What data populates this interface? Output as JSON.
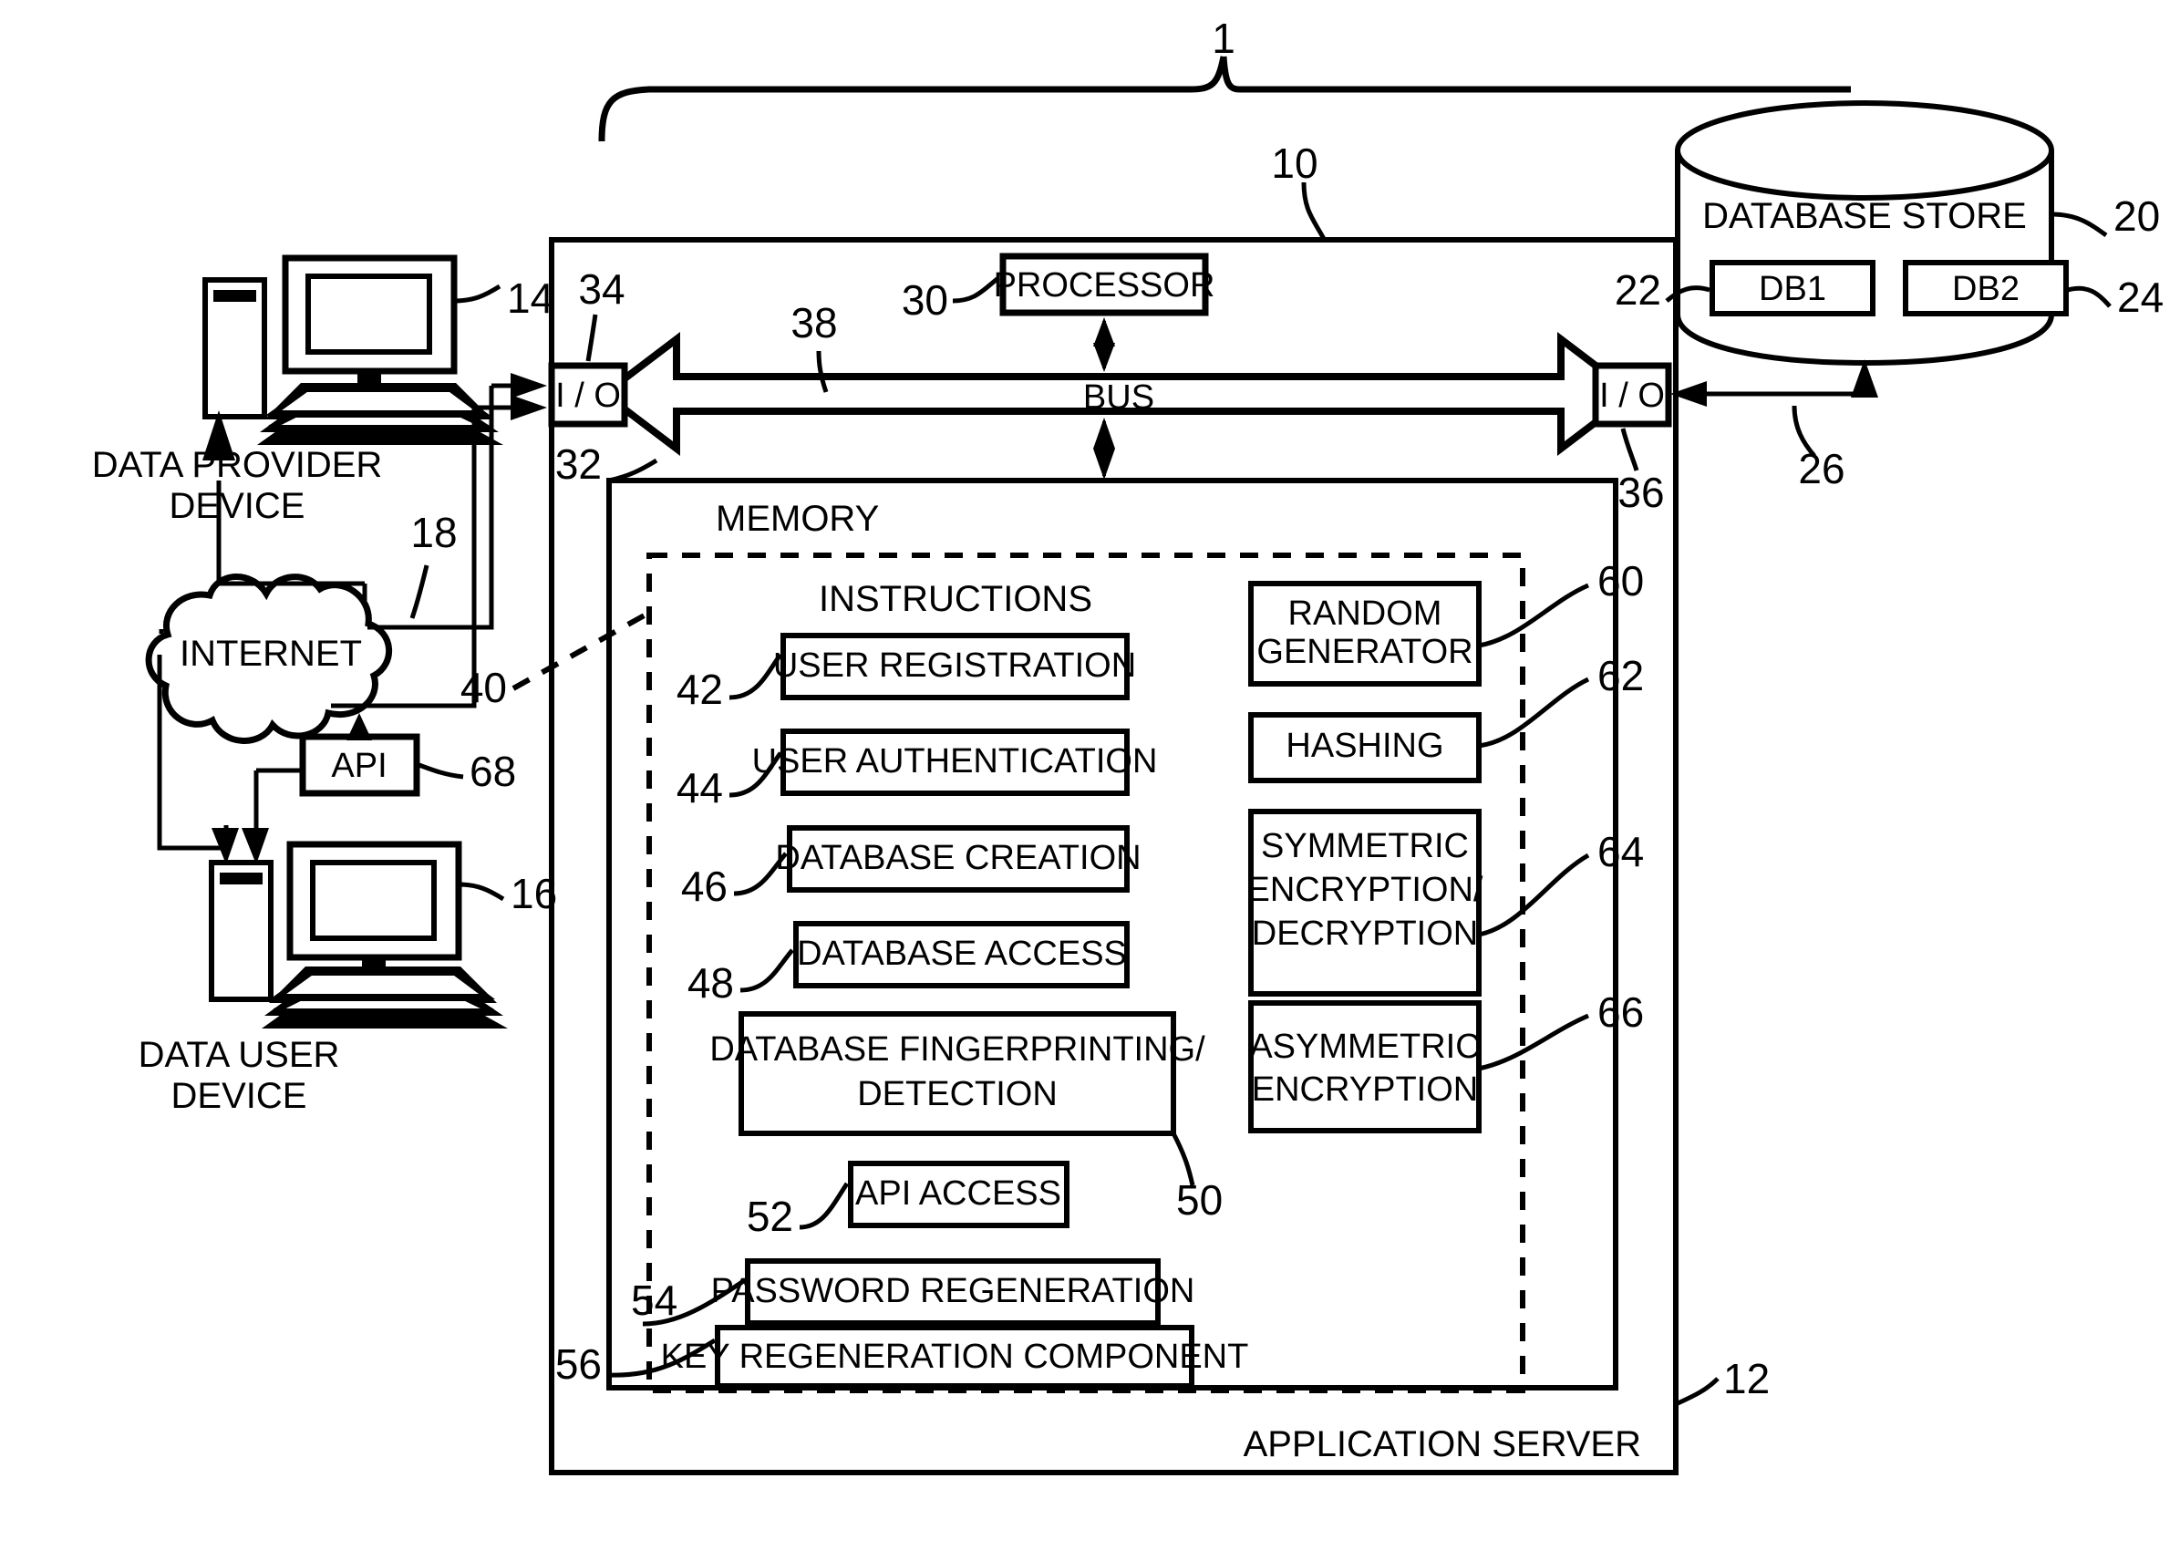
{
  "figure": {
    "overall_ref": "1",
    "system_ref": "10",
    "app_server_ref": "12",
    "app_server_label": "APPLICATION SERVER"
  },
  "devices": {
    "provider": {
      "label_line1": "DATA PROVIDER",
      "label_line2": "DEVICE",
      "ref": "14"
    },
    "user": {
      "label_line1": "DATA USER",
      "label_line2": "DEVICE",
      "ref": "16"
    },
    "internet": {
      "label": "INTERNET",
      "ref": "18"
    },
    "api": {
      "label": "API",
      "ref": "68"
    }
  },
  "database_store": {
    "title": "DATABASE STORE",
    "ref": "20",
    "db1": {
      "label": "DB1",
      "ref": "22"
    },
    "db2": {
      "label": "DB2",
      "ref": "24"
    },
    "link_ref": "26"
  },
  "server": {
    "processor": {
      "label": "PROCESSOR",
      "ref": "30"
    },
    "bus": {
      "label": "BUS",
      "ref": "38"
    },
    "io_left": {
      "label": "I / O",
      "ref": "34"
    },
    "io_right": {
      "label": "I / O",
      "ref": "36"
    },
    "memory": {
      "label": "MEMORY",
      "ref": "32"
    },
    "instructions": {
      "label": "INSTRUCTIONS",
      "ref": "40"
    }
  },
  "instruction_blocks": [
    {
      "label": "USER REGISTRATION",
      "ref": "42"
    },
    {
      "label": "USER AUTHENTICATION",
      "ref": "44"
    },
    {
      "label": "DATABASE CREATION",
      "ref": "46"
    },
    {
      "label": "DATABASE ACCESS",
      "ref": "48"
    },
    {
      "label_line1": "DATABASE FINGERPRINTING/",
      "label_line2": "DETECTION",
      "ref": "50"
    },
    {
      "label": "API ACCESS",
      "ref": "52"
    },
    {
      "label": "PASSWORD REGENERATION",
      "ref": "54"
    },
    {
      "label": "KEY REGENERATION COMPONENT",
      "ref": "56"
    }
  ],
  "crypto_blocks": [
    {
      "label_line1": "RANDOM",
      "label_line2": "GENERATOR",
      "ref": "60"
    },
    {
      "label_line1": "HASHING",
      "label_line2": "",
      "ref": "62"
    },
    {
      "label_line1": "SYMMETRIC",
      "label_line2": "ENCRYPTION/",
      "label_line3": "DECRYPTION",
      "ref": "64"
    },
    {
      "label_line1": "ASYMMETRIC",
      "label_line2": "ENCRYPTION",
      "label_line3": "",
      "ref": "66"
    }
  ]
}
